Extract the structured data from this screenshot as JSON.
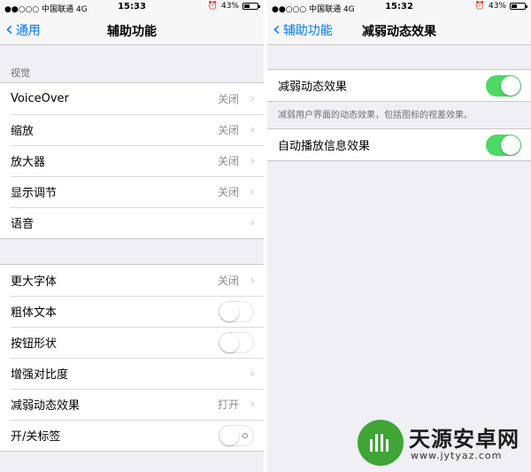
{
  "left": {
    "status": {
      "signal": "●●○○○ 中国联通 4G",
      "time": "15:33",
      "alarm": "⏰",
      "battery": "43%",
      "battery_level": 0.43
    },
    "nav": {
      "back_label": "通用",
      "title": "辅助功能"
    },
    "section_header": "视觉",
    "group1": [
      {
        "label": "VoiceOver",
        "value": "关闭"
      },
      {
        "label": "缩放",
        "value": "关闭"
      },
      {
        "label": "放大器",
        "value": "关闭"
      },
      {
        "label": "显示调节",
        "value": "关闭"
      },
      {
        "label": "语音",
        "value": ""
      }
    ],
    "group2": [
      {
        "label": "更大字体",
        "value": "关闭"
      },
      {
        "label": "粗体文本"
      },
      {
        "label": "按钮形状"
      },
      {
        "label": "增强对比度"
      },
      {
        "label": "减弱动态效果",
        "value": "打开"
      },
      {
        "label": "开/关标签"
      }
    ]
  },
  "right": {
    "status": {
      "signal": "●●○○○ 中国联通 4G",
      "time": "15:32",
      "alarm": "⏰",
      "battery": "43%",
      "battery_level": 0.43
    },
    "nav": {
      "back_label": "辅助功能",
      "title": "减弱动态效果"
    },
    "row1": {
      "label": "减弱动态效果",
      "on": true
    },
    "note": "减弱用户界面的动态效果，包括图标的视差效果。",
    "row2": {
      "label": "自动播放信息效果",
      "on": true
    }
  },
  "watermark": {
    "name": "天源安卓网",
    "url": "www.jytyaz.com"
  },
  "colors": {
    "accent": "#007aff",
    "toggle_on": "#4cd964",
    "background": "#efeff4"
  }
}
